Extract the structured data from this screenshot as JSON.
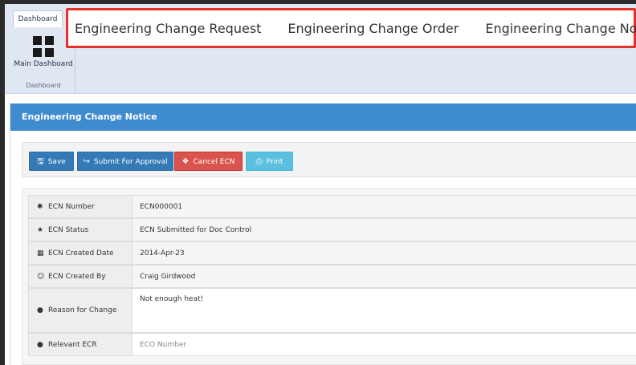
{
  "ribbon": {
    "tab_label": "Dashboard",
    "button_label": "Main Dashboard",
    "group_label": "Dashboard"
  },
  "topnav": {
    "items": [
      "Engineering Change Request",
      "Engineering Change Order",
      "Engineering Change Notice"
    ]
  },
  "panel": {
    "title": "Engineering Change Notice"
  },
  "toolbar": {
    "save_label": "Save",
    "submit_label": "Submit For Approval",
    "cancel_label": "Cancel ECN",
    "print_label": "Print"
  },
  "form": {
    "rows": [
      {
        "icon": "bug-icon",
        "label": "ECN Number",
        "value": "ECN000001"
      },
      {
        "icon": "star-icon",
        "label": "ECN Status",
        "value": "ECN Submitted for Doc Control"
      },
      {
        "icon": "calendar-icon",
        "label": "ECN Created Date",
        "value": "2014-Apr-23"
      },
      {
        "icon": "user-icon",
        "label": "ECN Created By",
        "value": "Craig Girdwood"
      },
      {
        "icon": "comment-icon",
        "label": "Reason for Change",
        "value": "Not enough heat!"
      },
      {
        "icon": "comment-icon",
        "label": "Relevant ECR",
        "placeholder": "ECO Number"
      }
    ]
  },
  "colors": {
    "header_blue": "#3f8bd0",
    "primary": "#337ab7",
    "danger": "#d9534f",
    "info": "#5bc0de",
    "highlight_box": "#e8302a"
  }
}
